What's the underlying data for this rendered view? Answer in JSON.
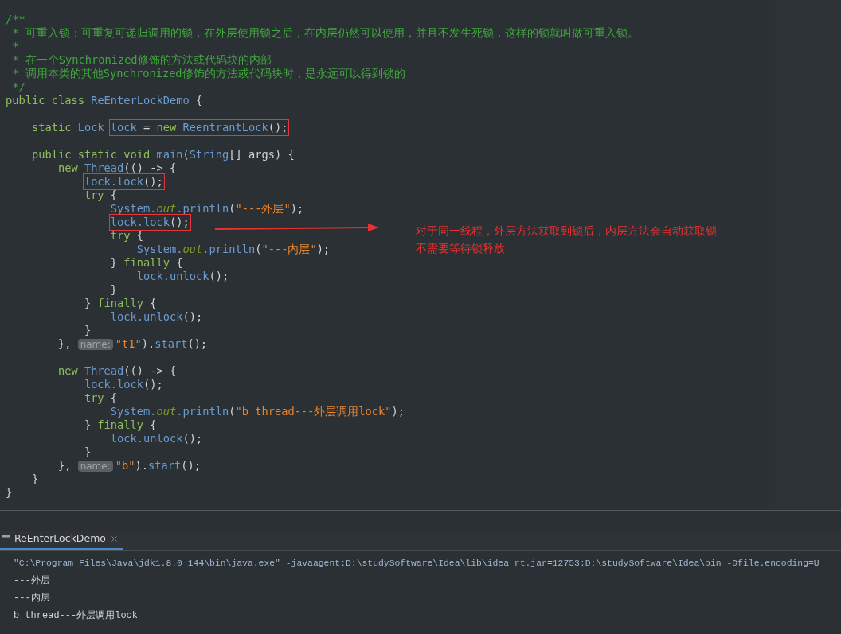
{
  "editor": {
    "lines": [
      {
        "segments": [
          {
            "kind": "code",
            "tokens": [
              {
                "kind": "c",
                "text": "/**"
              }
            ]
          }
        ]
      },
      {
        "segments": [
          {
            "kind": "code",
            "tokens": [
              {
                "kind": "c",
                "text": " * 可重入锁：可重复可递归调用的锁，在外层使用锁之后，在内层仍然可以使用，并且不发生死锁，这样的锁就叫做可重入锁。"
              }
            ]
          }
        ]
      },
      {
        "segments": [
          {
            "kind": "code",
            "tokens": [
              {
                "kind": "c",
                "text": " *"
              }
            ]
          }
        ]
      },
      {
        "segments": [
          {
            "kind": "code",
            "tokens": [
              {
                "kind": "c",
                "text": " * 在一个Synchronized修饰的方法或代码块的内部"
              }
            ]
          }
        ]
      },
      {
        "segments": [
          {
            "kind": "code",
            "tokens": [
              {
                "kind": "c",
                "text": " * 调用本类的其他Synchronized修饰的方法或代码块时，是永远可以得到锁的"
              }
            ]
          }
        ]
      },
      {
        "segments": [
          {
            "kind": "code",
            "tokens": [
              {
                "kind": "c",
                "text": " */"
              }
            ]
          }
        ]
      },
      {
        "segments": [
          {
            "kind": "code",
            "tokens": [
              {
                "kind": "k",
                "text": "public class "
              },
              {
                "kind": "i",
                "text": "ReEnterLockDemo"
              },
              {
                "kind": "p",
                "text": " {"
              }
            ]
          }
        ]
      },
      {
        "kind": "blank"
      },
      {
        "segments": [
          {
            "kind": "code",
            "tokens": [
              {
                "kind": "k",
                "text": "    static "
              },
              {
                "kind": "i",
                "text": "Lock "
              }
            ]
          },
          {
            "kind": "box",
            "tokens": [
              {
                "kind": "i",
                "text": "lock"
              },
              {
                "kind": "p",
                "text": " = "
              },
              {
                "kind": "k",
                "text": "new "
              },
              {
                "kind": "i",
                "text": "ReentrantLock"
              },
              {
                "kind": "p",
                "text": "();"
              }
            ]
          }
        ]
      },
      {
        "kind": "blank"
      },
      {
        "segments": [
          {
            "kind": "code",
            "tokens": [
              {
                "kind": "k",
                "text": "    public static void "
              },
              {
                "kind": "i",
                "text": "main"
              },
              {
                "kind": "p",
                "text": "("
              },
              {
                "kind": "i",
                "text": "String"
              },
              {
                "kind": "p",
                "text": "[] args) {"
              }
            ]
          }
        ]
      },
      {
        "segments": [
          {
            "kind": "code",
            "tokens": [
              {
                "kind": "k",
                "text": "        new "
              },
              {
                "kind": "i",
                "text": "Thread"
              },
              {
                "kind": "p",
                "text": "(() -> {"
              }
            ]
          }
        ]
      },
      {
        "segments": [
          {
            "kind": "box",
            "tokens": [
              {
                "kind": "i",
                "text": "            lock.lock"
              },
              {
                "kind": "p",
                "text": "();"
              }
            ]
          }
        ]
      },
      {
        "segments": [
          {
            "kind": "code",
            "tokens": [
              {
                "kind": "k",
                "text": "            try "
              },
              {
                "kind": "p",
                "text": "{"
              }
            ]
          }
        ]
      },
      {
        "segments": [
          {
            "kind": "code",
            "tokens": [
              {
                "kind": "i",
                "text": "                System."
              },
              {
                "kind": "f",
                "text": "out"
              },
              {
                "kind": "i",
                "text": ".println"
              },
              {
                "kind": "p",
                "text": "("
              },
              {
                "kind": "s",
                "text": "\"---外层\""
              },
              {
                "kind": "p",
                "text": ");"
              }
            ]
          }
        ]
      },
      {
        "segments": [
          {
            "kind": "box",
            "tokens": [
              {
                "kind": "i",
                "text": "                lock.lock"
              },
              {
                "kind": "p",
                "text": "();"
              }
            ]
          }
        ]
      },
      {
        "segments": [
          {
            "kind": "code",
            "tokens": [
              {
                "kind": "k",
                "text": "                try "
              },
              {
                "kind": "p",
                "text": "{"
              }
            ]
          }
        ]
      },
      {
        "segments": [
          {
            "kind": "code",
            "tokens": [
              {
                "kind": "i",
                "text": "                    System."
              },
              {
                "kind": "f",
                "text": "out"
              },
              {
                "kind": "i",
                "text": ".println"
              },
              {
                "kind": "p",
                "text": "("
              },
              {
                "kind": "s",
                "text": "\"---内层\""
              },
              {
                "kind": "p",
                "text": ");"
              }
            ]
          }
        ]
      },
      {
        "segments": [
          {
            "kind": "code",
            "tokens": [
              {
                "kind": "p",
                "text": "                } "
              },
              {
                "kind": "k",
                "text": "finally "
              },
              {
                "kind": "p",
                "text": "{"
              }
            ]
          }
        ]
      },
      {
        "segments": [
          {
            "kind": "code",
            "tokens": [
              {
                "kind": "i",
                "text": "                    lock.unlock"
              },
              {
                "kind": "p",
                "text": "();"
              }
            ]
          }
        ]
      },
      {
        "segments": [
          {
            "kind": "code",
            "tokens": [
              {
                "kind": "p",
                "text": "                }"
              }
            ]
          }
        ]
      },
      {
        "segments": [
          {
            "kind": "code",
            "tokens": [
              {
                "kind": "p",
                "text": "            } "
              },
              {
                "kind": "k",
                "text": "finally "
              },
              {
                "kind": "p",
                "text": "{"
              }
            ]
          }
        ]
      },
      {
        "segments": [
          {
            "kind": "code",
            "tokens": [
              {
                "kind": "i",
                "text": "                lock.unlock"
              },
              {
                "kind": "p",
                "text": "();"
              }
            ]
          }
        ]
      },
      {
        "segments": [
          {
            "kind": "code",
            "tokens": [
              {
                "kind": "p",
                "text": "            }"
              }
            ]
          }
        ]
      },
      {
        "segments": [
          {
            "kind": "code",
            "tokens": [
              {
                "kind": "p",
                "text": "        }, "
              }
            ]
          },
          {
            "kind": "hint",
            "text": "name:"
          },
          {
            "kind": "code",
            "tokens": [
              {
                "kind": "s",
                "text": "\"t1\""
              },
              {
                "kind": "p",
                "text": ")."
              },
              {
                "kind": "i",
                "text": "start"
              },
              {
                "kind": "p",
                "text": "();"
              }
            ]
          }
        ]
      },
      {
        "kind": "blank"
      },
      {
        "segments": [
          {
            "kind": "code",
            "tokens": [
              {
                "kind": "k",
                "text": "        new "
              },
              {
                "kind": "i",
                "text": "Thread"
              },
              {
                "kind": "p",
                "text": "(() -> {"
              }
            ]
          }
        ]
      },
      {
        "segments": [
          {
            "kind": "code",
            "tokens": [
              {
                "kind": "i",
                "text": "            lock.lock"
              },
              {
                "kind": "p",
                "text": "();"
              }
            ]
          }
        ]
      },
      {
        "segments": [
          {
            "kind": "code",
            "tokens": [
              {
                "kind": "k",
                "text": "            try "
              },
              {
                "kind": "p",
                "text": "{"
              }
            ]
          }
        ]
      },
      {
        "segments": [
          {
            "kind": "code",
            "tokens": [
              {
                "kind": "i",
                "text": "                System."
              },
              {
                "kind": "f",
                "text": "out"
              },
              {
                "kind": "i",
                "text": ".println"
              },
              {
                "kind": "p",
                "text": "("
              },
              {
                "kind": "s",
                "text": "\"b thread---外层调用lock\""
              },
              {
                "kind": "p",
                "text": ");"
              }
            ]
          }
        ]
      },
      {
        "segments": [
          {
            "kind": "code",
            "tokens": [
              {
                "kind": "p",
                "text": "            } "
              },
              {
                "kind": "k",
                "text": "finally "
              },
              {
                "kind": "p",
                "text": "{"
              }
            ]
          }
        ]
      },
      {
        "segments": [
          {
            "kind": "code",
            "tokens": [
              {
                "kind": "i",
                "text": "                lock.unlock"
              },
              {
                "kind": "p",
                "text": "();"
              }
            ]
          }
        ]
      },
      {
        "segments": [
          {
            "kind": "code",
            "tokens": [
              {
                "kind": "p",
                "text": "            }"
              }
            ]
          }
        ]
      },
      {
        "segments": [
          {
            "kind": "code",
            "tokens": [
              {
                "kind": "p",
                "text": "        }, "
              }
            ]
          },
          {
            "kind": "hint",
            "text": "name:"
          },
          {
            "kind": "code",
            "tokens": [
              {
                "kind": "s",
                "text": "\"b\""
              },
              {
                "kind": "p",
                "text": ")."
              },
              {
                "kind": "i",
                "text": "start"
              },
              {
                "kind": "p",
                "text": "();"
              }
            ]
          }
        ]
      },
      {
        "segments": [
          {
            "kind": "code",
            "tokens": [
              {
                "kind": "p",
                "text": "    }"
              }
            ]
          }
        ]
      },
      {
        "segments": [
          {
            "kind": "code",
            "tokens": [
              {
                "kind": "p",
                "text": "}"
              }
            ]
          }
        ]
      }
    ]
  },
  "annotation": {
    "lines": [
      "对于同一线程，外层方法获取到锁后，内层方法会自动获取锁",
      "不需要等待锁释放"
    ]
  },
  "run_panel": {
    "tabs": [
      {
        "label": "ReEnterLockDemo",
        "selected": true
      }
    ],
    "console": [
      {
        "kind": "command",
        "text": "\"C:\\Program Files\\Java\\jdk1.8.0_144\\bin\\java.exe\" -javaagent:D:\\studySoftware\\Idea\\lib\\idea_rt.jar=12753:D:\\studySoftware\\Idea\\bin -Dfile.encoding=U"
      },
      {
        "kind": "output",
        "text": "---外层"
      },
      {
        "kind": "output",
        "text": "---内层"
      },
      {
        "kind": "output",
        "text": "b thread---外层调用lock"
      }
    ]
  }
}
